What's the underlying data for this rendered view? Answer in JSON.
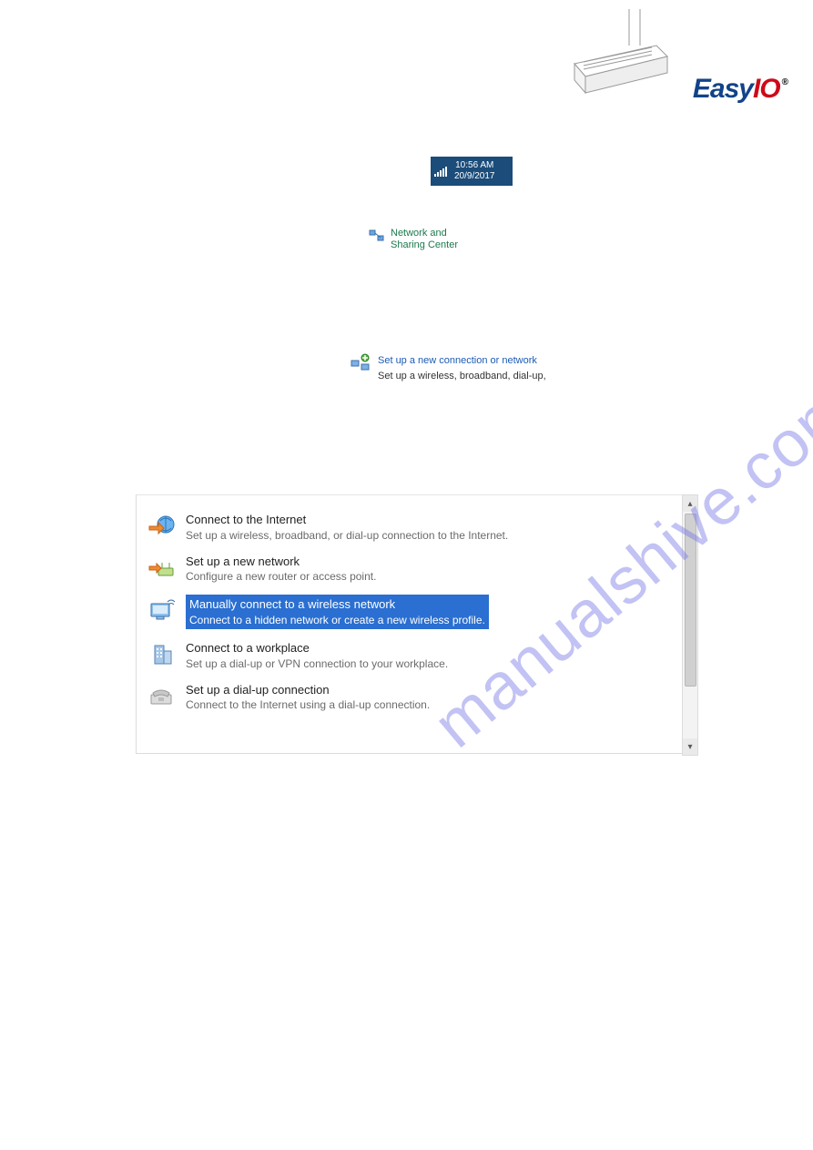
{
  "brand": {
    "easy": "Easy",
    "io": "IO",
    "reg": "®"
  },
  "watermark": "manualshive.com",
  "tray": {
    "time": "10:56 AM",
    "date": "20/9/2017"
  },
  "netshare": {
    "label": "Network and Sharing Center"
  },
  "setup_link": {
    "title": "Set up a new connection or network",
    "sub": "Set up a wireless, broadband, dial-up,"
  },
  "options": [
    {
      "title": "Connect to the Internet",
      "sub": "Set up a wireless, broadband, or dial-up connection to the Internet.",
      "selected": false
    },
    {
      "title": "Set up a new network",
      "sub": "Configure a new router or access point.",
      "selected": false
    },
    {
      "title": "Manually connect to a wireless network",
      "sub": "Connect to a hidden network or create a new wireless profile.",
      "selected": true
    },
    {
      "title": "Connect to a workplace",
      "sub": "Set up a dial-up or VPN connection to your workplace.",
      "selected": false
    },
    {
      "title": "Set up a dial-up connection",
      "sub": "Connect to the Internet using a dial-up connection.",
      "selected": false
    }
  ],
  "scroll": {
    "up": "▴",
    "down": "▾"
  }
}
